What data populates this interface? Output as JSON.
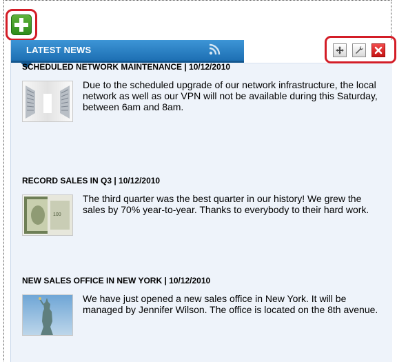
{
  "widget": {
    "title": "LATEST NEWS",
    "icons": {
      "add": "plus-icon",
      "rss": "rss-icon",
      "move": "move-icon",
      "settings": "wrench-icon",
      "close": "close-icon"
    },
    "colors": {
      "tab": "#2a82c8",
      "highlight": "#d31d27",
      "add_button": "#3b9b27",
      "panel_background": "#eef3fa"
    }
  },
  "news": [
    {
      "headline": "SCHEDULED NETWORK MAINTENANCE | 10/12/2010",
      "text": "Due to the scheduled upgrade of our network infrastructure, the local network as well as our VPN will not be available during this Saturday, between 6am and 8am.",
      "image": "server-room-image"
    },
    {
      "headline": "RECORD SALES IN Q3 | 10/12/2010",
      "text": "The third quarter was the best quarter in our history! We grew the sales by 70% year-to-year. Thanks to everybody to their hard work.",
      "image": "money-image"
    },
    {
      "headline": "NEW SALES OFFICE IN NEW YORK | 10/12/2010",
      "text": "We have just opened a new sales office in New York. It will be managed by Jennifer Wilson. The office is located on the 8th avenue.",
      "image": "statue-of-liberty-image"
    }
  ]
}
